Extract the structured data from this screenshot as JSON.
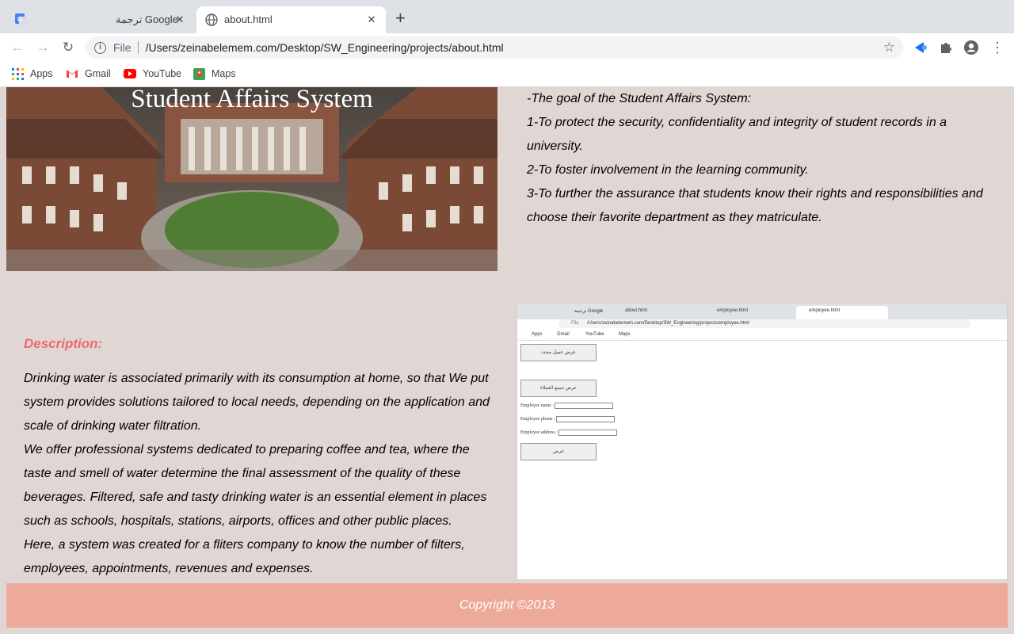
{
  "browser": {
    "tabs": [
      {
        "title": "ترجمة Google"
      },
      {
        "title": "about.html"
      }
    ],
    "new_tab_label": "+",
    "address_scheme": "File",
    "address_url": "/Users/zeinabelemem.com/Desktop/SW_Engineering/projects/about.html",
    "bookmarks": [
      {
        "label": "Apps",
        "icon": "apps-grid-icon"
      },
      {
        "label": "Gmail",
        "icon": "gmail-icon"
      },
      {
        "label": "YouTube",
        "icon": "youtube-icon"
      },
      {
        "label": "Maps",
        "icon": "maps-icon"
      }
    ]
  },
  "hero": {
    "title": "Student Affairs System"
  },
  "goals": {
    "lines": [
      "-The goal of the Student Affairs System:",
      "1-To protect the security, confidentiality and integrity of student records in a university.",
      "2-To foster involvement in the learning community.",
      "3-To further the assurance that students know their rights and responsibilities and choose their favorite department as they matriculate."
    ]
  },
  "description": {
    "title": "Description:",
    "paragraphs": [
      "Drinking water is associated primarily with its consumption at home, so that We put system provides solutions tailored to local needs, depending on the application and scale of drinking water filtration.",
      "We offer professional systems dedicated to preparing coffee and tea, where the taste and smell of water determine the final assessment of the quality of these beverages. Filtered, safe and tasty drinking water is an essential element in places such as schools, hospitals, stations, airports, offices and other public places.",
      "Here, a system was created for a fliters company to know the number of filters, employees, appointments, revenues and expenses."
    ]
  },
  "screenshot": {
    "tabs": [
      "ترجمة Google",
      "about.html",
      "employee.html",
      "employee.html"
    ],
    "address_scheme": "File",
    "address_url": "/Users/zeinabelemem.com/Desktop/SW_Engineering/projects/employee.html",
    "bookmarks": [
      "Apps",
      "Gmail",
      "YouTube",
      "Maps"
    ],
    "button1": "عرض عميل محدد",
    "button2": "عرض جميع العملاء",
    "fields": [
      "Employee name :",
      "Employee phone :",
      "Employee address :"
    ],
    "submit": "عرض"
  },
  "footer": {
    "text": "Copyright ©2013"
  },
  "colors": {
    "accent": "#ee6a6a",
    "footer_bg": "#eda99a",
    "page_bg": "#e0d7d5"
  }
}
